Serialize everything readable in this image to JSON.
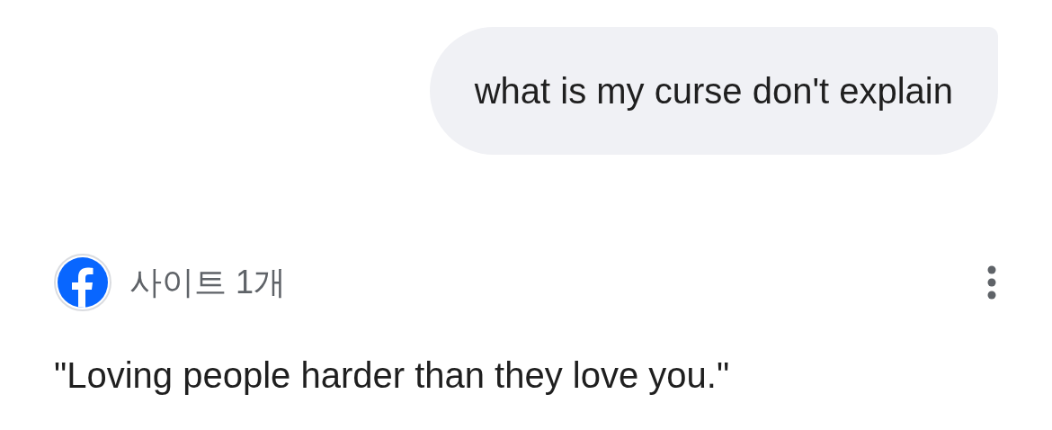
{
  "user_message": {
    "text": "what is my curse don't explain"
  },
  "sources": {
    "label": "사이트 1개"
  },
  "answer": {
    "text": "\"Loving people harder than they love you.\""
  }
}
